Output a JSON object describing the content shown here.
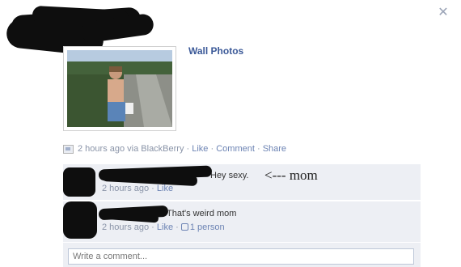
{
  "post": {
    "album_link": "Wall Photos",
    "time": "2 hours ago",
    "via": " via BlackBerry",
    "dot": " · ",
    "like": "Like",
    "comment": "Comment",
    "share": "Share"
  },
  "comments": [
    {
      "text": "Hey sexy.",
      "time": "2 hours ago",
      "dot": " · ",
      "like": "Like"
    },
    {
      "text": "That's weird mom",
      "time": "2 hours ago",
      "dot": " · ",
      "like": "Like",
      "dot2": " · ",
      "likes_count": "1 person"
    }
  ],
  "annotation": "<--- mom",
  "write_comment_placeholder": "Write a comment...",
  "icons": {
    "close": "close-icon",
    "post_type": "photo-post-icon",
    "like_thumb": "thumbs-up-icon"
  },
  "colors": {
    "link": "#3b5998",
    "muted_link": "#6d84b4",
    "comment_bg": "#edeff4",
    "redaction": "#0e0e0e"
  }
}
